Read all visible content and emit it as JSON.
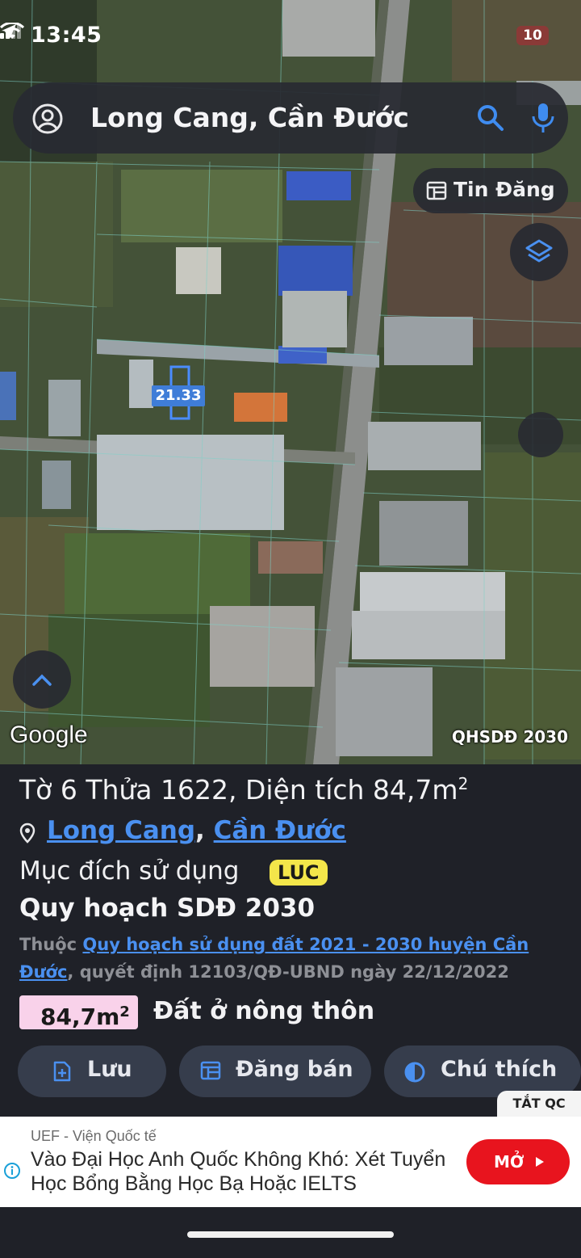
{
  "status_bar": {
    "time": "13:45",
    "battery": "10"
  },
  "search": {
    "query": "Long Cang, Cần Đước"
  },
  "map": {
    "tin_dang_label": "Tin Đăng",
    "parcel_label": "21.33",
    "attribution": "Google",
    "layer_name": "QHSDĐ 2030"
  },
  "parcel": {
    "title": "Tờ 6 Thửa 1622, Diện tích 84,7m",
    "title_sup": "2",
    "commune": "Long Cang",
    "district": "Cần Đước",
    "purpose_label": "Mục đích sử dụng",
    "purpose_code": "LUC",
    "plan_title": "Quy hoạch SDĐ 2030",
    "plan_prefix": "Thuộc ",
    "plan_link": "Quy hoạch sử dụng đất 2021 - 2030 huyện Cần Đước",
    "plan_suffix": ", quyết định 12103/QĐ-UBND ngày 22/12/2022",
    "area_value": "84,7m",
    "area_sup": "2",
    "land_type": "Đất ở nông thôn"
  },
  "actions": {
    "save": "Lưu",
    "sell": "Đăng bán",
    "legend": "Chú thích"
  },
  "ad": {
    "close_label": "TẮT QC",
    "advertiser": "UEF - Viện Quốc tế",
    "headline": "Vào Đại Học Anh Quốc Không Khó: Xét Tuyển Học Bổng Bằng Học Bạ Hoặc IELTS",
    "cta": "MỞ",
    "cta_color": "#e8141e"
  },
  "colors": {
    "link": "#4a90f0",
    "panel_bg": "#1f2128",
    "button_bg": "#363d4c",
    "badge_luc": "#f4e64a",
    "badge_area": "#f9d2ea"
  }
}
